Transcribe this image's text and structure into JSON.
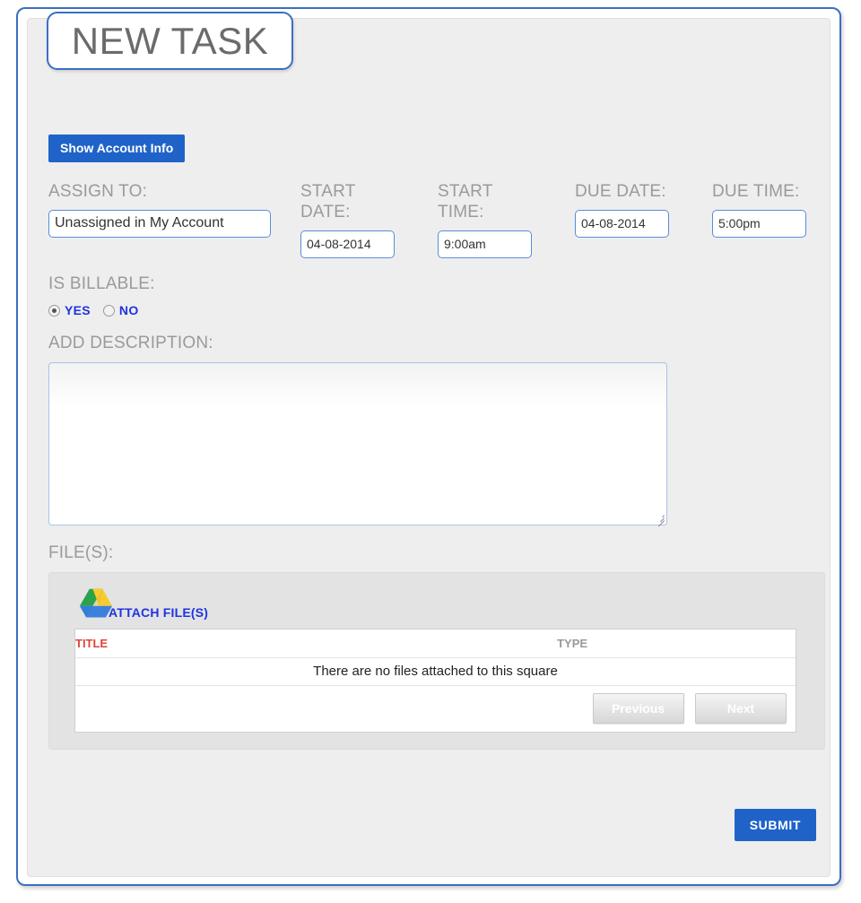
{
  "page": {
    "title": "NEW TASK"
  },
  "toolbar": {
    "show_account_info_label": "Show Account Info"
  },
  "form": {
    "assign_to": {
      "label": "ASSIGN TO:",
      "value": "Unassigned in My Account"
    },
    "start_date": {
      "label": "START DATE:",
      "value": "04-08-2014"
    },
    "start_time": {
      "label": "START TIME:",
      "value": "9:00am"
    },
    "due_date": {
      "label": "DUE DATE:",
      "value": "04-08-2014"
    },
    "due_time": {
      "label": "DUE TIME:",
      "value": "5:00pm"
    },
    "is_billable": {
      "label": "IS BILLABLE:",
      "options": [
        {
          "label": "YES",
          "selected": true
        },
        {
          "label": "NO",
          "selected": false
        }
      ]
    },
    "description": {
      "label": "ADD DESCRIPTION:",
      "value": "",
      "placeholder": ""
    }
  },
  "files": {
    "label": "FILE(S):",
    "attach_link_label": "ATTACH FILE(S)",
    "drive_icon": "google-drive-icon",
    "table": {
      "columns": [
        "TITLE",
        "TYPE"
      ],
      "empty_message": "There are no files attached to this square",
      "rows": []
    },
    "pager": {
      "previous_label": "Previous",
      "next_label": "Next"
    }
  },
  "actions": {
    "submit_label": "SUBMIT"
  },
  "colors": {
    "accent_blue": "#1f63c8",
    "border_blue": "#3a6fc4",
    "link_blue": "#1f33e0",
    "label_gray": "#9a9a9a",
    "title_red": "#e0443e",
    "page_bg": "#eeeeee"
  }
}
